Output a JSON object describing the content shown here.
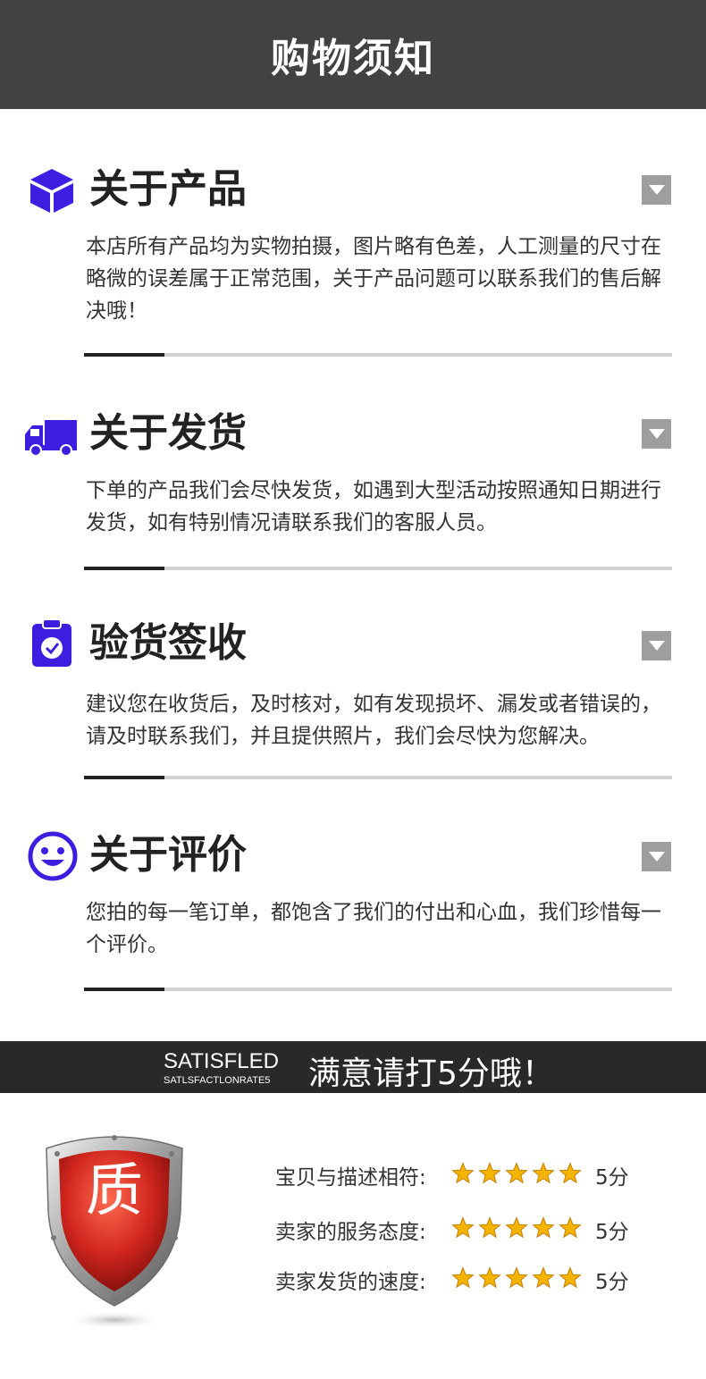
{
  "header": {
    "title": "购物须知"
  },
  "sections": [
    {
      "icon": "box-icon",
      "title": "关于产品",
      "body": "本店所有产品均为实物拍摄，图片略有色差，人工测量的尺寸在略微的误差属于正常范围，关于产品问题可以联系我们的售后解决哦！"
    },
    {
      "icon": "delivery-truck-icon",
      "title": "关于发货",
      "body": "下单的产品我们会尽快发货，如遇到大型活动按照通知日期进行发货，如有特别情况请联系我们的客服人员。"
    },
    {
      "icon": "clipboard-check-icon",
      "title": "验货签收",
      "body": "建议您在收货后，及时核对，如有发现损坏、漏发或者错误的，请及时联系我们，并且提供照片，我们会尽快为您解决。"
    },
    {
      "icon": "smiley-face-icon",
      "title": "关于评价",
      "body": "您拍的每一笔订单，都饱含了我们的付出和心血，我们珍惜每一个评价。"
    }
  ],
  "banner": {
    "en_title": "SATISFLED",
    "en_subtitle": "SATLSFACTLONRATE5",
    "cn_text": "满意请打5分哦！"
  },
  "shield": {
    "label": "质"
  },
  "ratings": [
    {
      "label": "宝贝与描述相符:",
      "stars": 5,
      "score": "5分"
    },
    {
      "label": "卖家的服务态度:",
      "stars": 5,
      "score": "5分"
    },
    {
      "label": "卖家发货的速度:",
      "stars": 5,
      "score": "5分"
    }
  ],
  "colors": {
    "header_bg": "#424242",
    "icon_accent": "#3d1ee0",
    "banner_bg": "#292929",
    "star": "#f5b400",
    "shield_red": "#c8231e"
  }
}
